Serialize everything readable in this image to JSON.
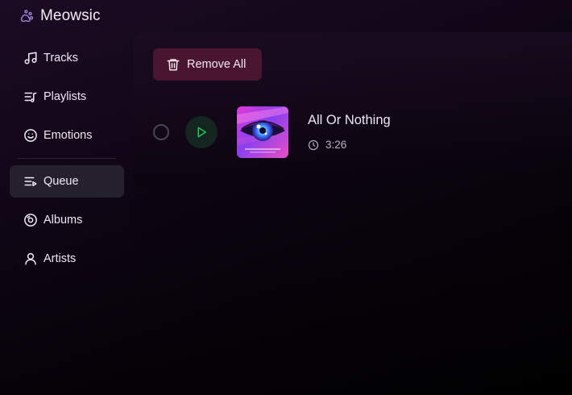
{
  "app": {
    "title": "Meowsic",
    "logo_icon": "paw-icon",
    "accent_color": "#a58ce0"
  },
  "sidebar": {
    "items": [
      {
        "label": "Tracks",
        "icon": "music-note-icon",
        "active": false
      },
      {
        "label": "Playlists",
        "icon": "playlist-icon",
        "active": false
      },
      {
        "label": "Emotions",
        "icon": "smiley-icon",
        "active": false
      },
      {
        "label": "Queue",
        "icon": "queue-icon",
        "active": true
      },
      {
        "label": "Albums",
        "icon": "disc-icon",
        "active": false
      },
      {
        "label": "Artists",
        "icon": "person-icon",
        "active": false
      }
    ]
  },
  "queue": {
    "remove_all_label": "Remove All",
    "remove_all_icon": "trash-icon",
    "remove_all_color": "#4a1530",
    "tracks": [
      {
        "title": "All Or Nothing",
        "duration": "3:26",
        "duration_icon": "clock-icon",
        "play_icon": "play-icon",
        "play_color": "#22c55e",
        "selected": false
      }
    ]
  }
}
